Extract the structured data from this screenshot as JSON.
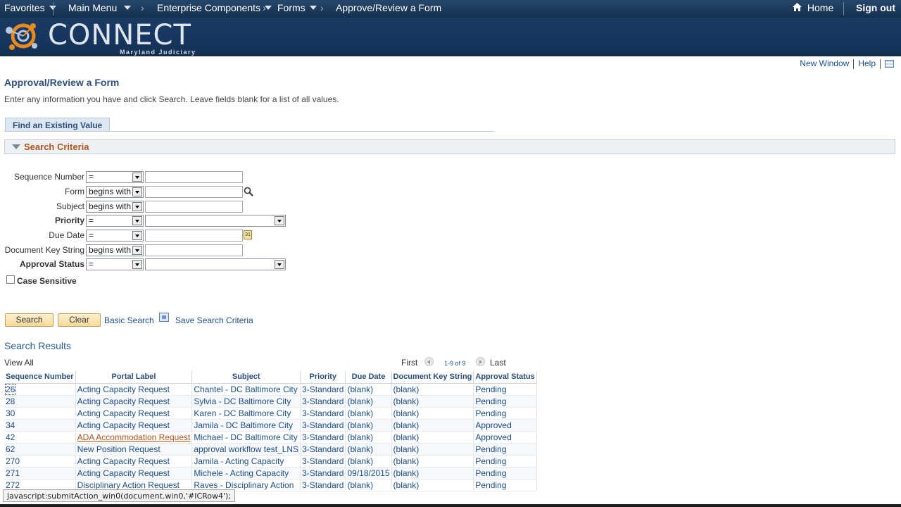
{
  "nav": {
    "favorites": "Favorites",
    "main_menu": "Main Menu",
    "breadcrumbs": [
      "Enterprise Components",
      "Forms",
      "Approve/Review a Form"
    ],
    "home": "Home",
    "sign_out": "Sign out"
  },
  "banner": {
    "title": "CONNECT",
    "subtitle": "Maryland Judiciary"
  },
  "utility": {
    "new_window": "New Window",
    "help": "Help"
  },
  "page": {
    "title": "Approval/Review a Form",
    "instructions": "Enter any information you have and click Search. Leave fields blank for a list of all values.",
    "tab": "Find an Existing Value",
    "section": "Search Criteria"
  },
  "criteria": [
    {
      "label": "Sequence Number",
      "operator": "=",
      "value": ""
    },
    {
      "label": "Form",
      "operator": "begins with",
      "value": ""
    },
    {
      "label": "Subject",
      "operator": "begins with",
      "value": ""
    },
    {
      "label": "Priority",
      "operator": "=",
      "value": ""
    },
    {
      "label": "Due Date",
      "operator": "=",
      "value": ""
    },
    {
      "label": "Document Key String",
      "operator": "begins with",
      "value": ""
    },
    {
      "label": "Approval Status",
      "operator": "=",
      "value": ""
    }
  ],
  "case_sensitive": "Case Sensitive",
  "buttons": {
    "search": "Search",
    "clear": "Clear",
    "basic_search": "Basic Search",
    "save_search": "Save Search Criteria"
  },
  "results": {
    "title": "Search Results",
    "view_all": "View All",
    "first": "First",
    "last": "Last",
    "count": "1-9 of 9",
    "columns": [
      "Sequence Number",
      "Portal Label",
      "Subject",
      "Priority",
      "Due Date",
      "Document Key String",
      "Approval Status"
    ],
    "rows": [
      [
        "26",
        "Acting Capacity Request",
        "Chantel - DC Baltimore City",
        "3-Standard",
        "(blank)",
        "(blank)",
        "Pending"
      ],
      [
        "28",
        "Acting Capacity Request",
        "Sylvia - DC Baltimore City",
        "3-Standard",
        "(blank)",
        "(blank)",
        "Pending"
      ],
      [
        "30",
        "Acting Capacity Request",
        "Karen - DC Baltimore City",
        "3-Standard",
        "(blank)",
        "(blank)",
        "Pending"
      ],
      [
        "34",
        "Acting Capacity Request",
        "Jamila - DC Baltimore City",
        "3-Standard",
        "(blank)",
        "(blank)",
        "Approved"
      ],
      [
        "42",
        "ADA Accommodation Request",
        "Michael - DC Baltimore City",
        "3-Standard",
        "(blank)",
        "(blank)",
        "Approved"
      ],
      [
        "62",
        "New Position Request",
        "approval workflow test_LNS",
        "3-Standard",
        "(blank)",
        "(blank)",
        "Pending"
      ],
      [
        "270",
        "Acting Capacity Request",
        "Jamila - Acting Capacity",
        "3-Standard",
        "(blank)",
        "(blank)",
        "Pending"
      ],
      [
        "271",
        "Acting Capacity Request",
        "Michele - Acting Capacity",
        "3-Standard",
        "09/18/2015",
        "(blank)",
        "Pending"
      ],
      [
        "272",
        "Disciplinary Action Request",
        "Raves - Disciplinary Action",
        "3-Standard",
        "(blank)",
        "(blank)",
        "Pending"
      ]
    ]
  },
  "statusbar": "javascript:submitAction_win0(document.win0,'#ICRow4');"
}
